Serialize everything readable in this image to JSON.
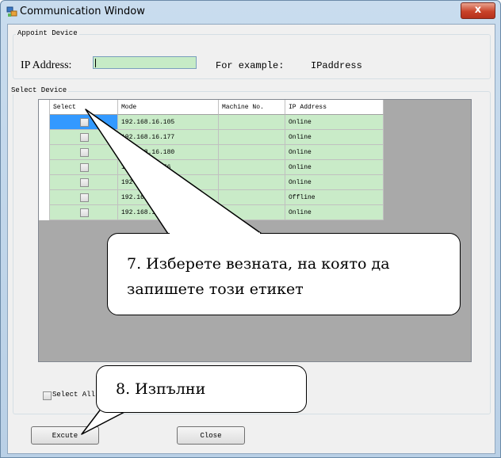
{
  "window": {
    "title": "Communication Window",
    "close_glyph": "x",
    "app_icon": "app-icon"
  },
  "appoint": {
    "group_title": "Appoint  Device",
    "ip_label": "IP Address:",
    "ip_value": "",
    "example_label": "For example:",
    "example_value": "IPaddress"
  },
  "select_group": {
    "group_title": "Select  Device",
    "columns": [
      "Select",
      "Mode",
      "Machine No.",
      "IP Address"
    ],
    "rows": [
      {
        "checked": false,
        "mode": "192.168.16.105",
        "machine_no": "",
        "ip_address": "Online"
      },
      {
        "checked": false,
        "mode": "192.168.16.177",
        "machine_no": "",
        "ip_address": "Online"
      },
      {
        "checked": false,
        "mode": "192.168.16.180",
        "machine_no": "",
        "ip_address": "Online"
      },
      {
        "checked": false,
        "mode": "192.168.16.76",
        "machine_no": "",
        "ip_address": "Online"
      },
      {
        "checked": false,
        "mode": "192.1",
        "machine_no": "",
        "ip_address": "Online"
      },
      {
        "checked": false,
        "mode": "192.16",
        "machine_no": "",
        "ip_address": "Offline"
      },
      {
        "checked": false,
        "mode": "192.168.1",
        "machine_no": "",
        "ip_address": "Online"
      }
    ],
    "select_all_label": "Select All"
  },
  "buttons": {
    "execute": "Excute",
    "close": "Close"
  },
  "callouts": {
    "step7_line1": "7. Изберете везната, на която да",
    "step7_line2": "запишете този етикет",
    "step8": "8. Изпълни"
  },
  "colors": {
    "row_bg": "#c9ebc8",
    "input_bg": "#c6ebc6",
    "selected_cell": "#3399ff",
    "grid_bg": "#a9a9a9"
  }
}
